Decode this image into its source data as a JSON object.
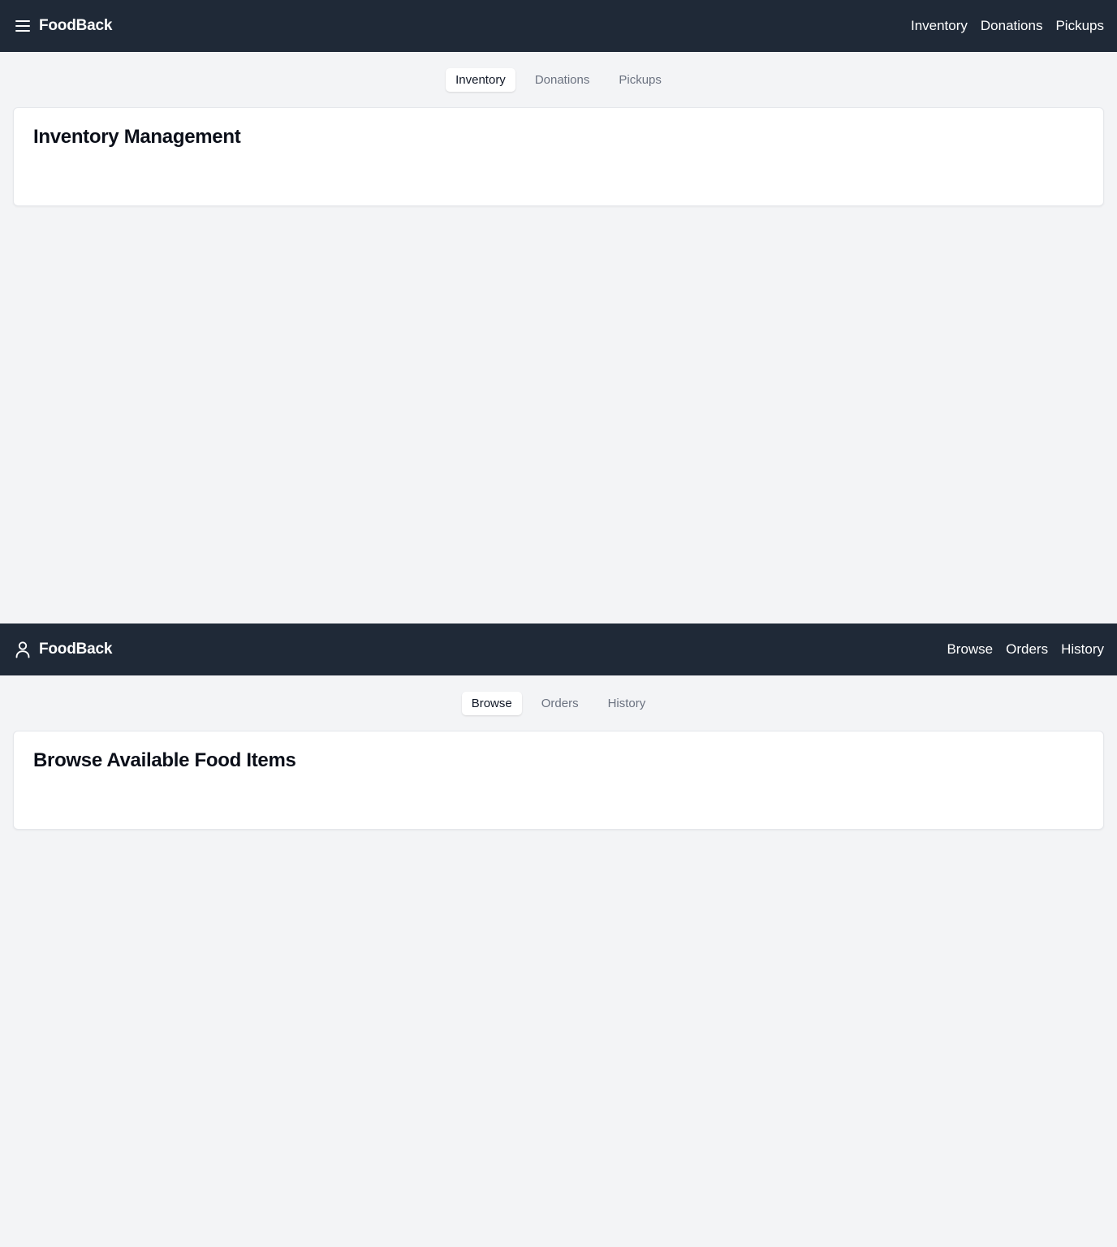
{
  "views": [
    {
      "brand": {
        "title": "FoodBack",
        "icon": "menu-icon"
      },
      "top_nav": [
        "Inventory",
        "Donations",
        "Pickups"
      ],
      "tabs": [
        {
          "label": "Inventory",
          "active": true
        },
        {
          "label": "Donations",
          "active": false
        },
        {
          "label": "Pickups",
          "active": false
        }
      ],
      "card": {
        "title": "Inventory Management"
      }
    },
    {
      "brand": {
        "title": "FoodBack",
        "icon": "user-icon"
      },
      "top_nav": [
        "Browse",
        "Orders",
        "History"
      ],
      "tabs": [
        {
          "label": "Browse",
          "active": true
        },
        {
          "label": "Orders",
          "active": false
        },
        {
          "label": "History",
          "active": false
        }
      ],
      "card": {
        "title": "Browse Available Food Items"
      }
    }
  ],
  "colors": {
    "header_bg": "#1f2937",
    "page_bg": "#f3f4f6",
    "card_bg": "#ffffff",
    "tab_inactive": "#6b7280"
  }
}
